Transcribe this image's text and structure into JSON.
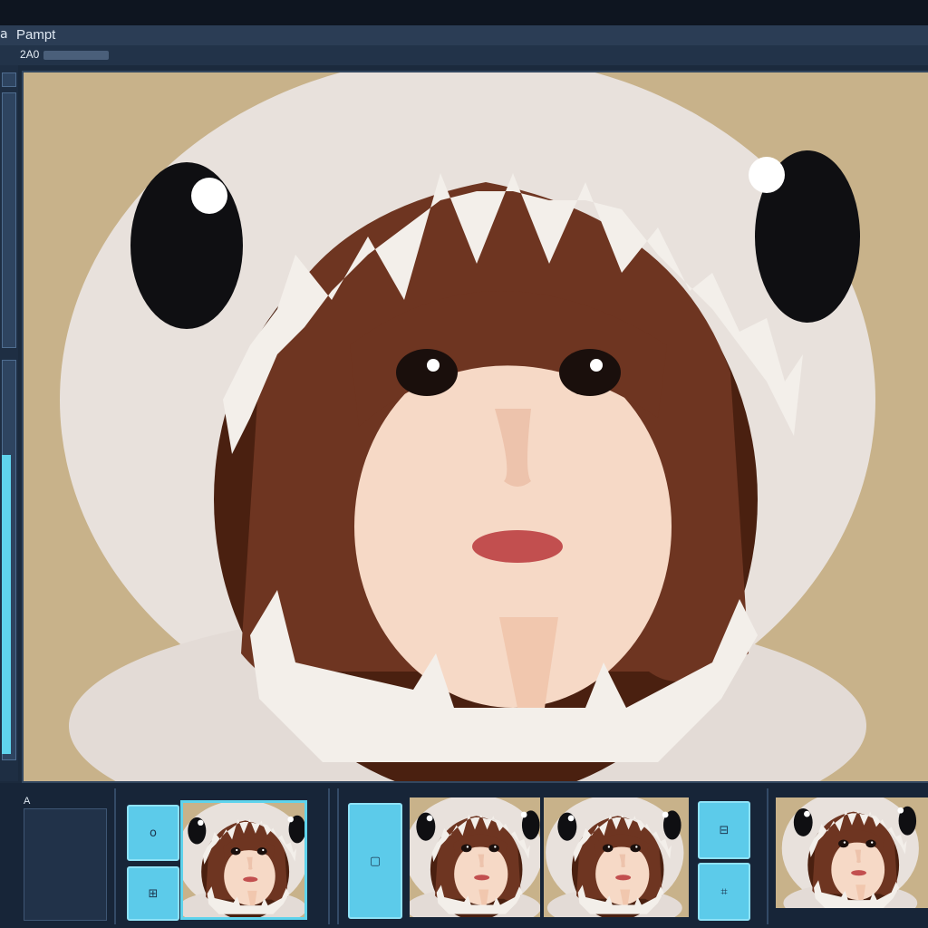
{
  "window": {
    "title": "Pampt",
    "title_prefix": "a"
  },
  "toolbar": {
    "code": "2A0"
  },
  "bottom": {
    "panel_label": "A"
  },
  "buttons": {
    "b1": "o",
    "b2": "⊞",
    "b3": "▢",
    "b4": "⊟",
    "b5": "⌗",
    "b6": "▣"
  },
  "colors": {
    "accent": "#5fd3ec",
    "panel": "#1b2a3d",
    "hood": "#ece6e2",
    "hair": "#6a3420",
    "background": "#c9b48d"
  },
  "image": {
    "subject": "girl in plush shark hood"
  },
  "thumbnails": {
    "selected_index": 0
  }
}
